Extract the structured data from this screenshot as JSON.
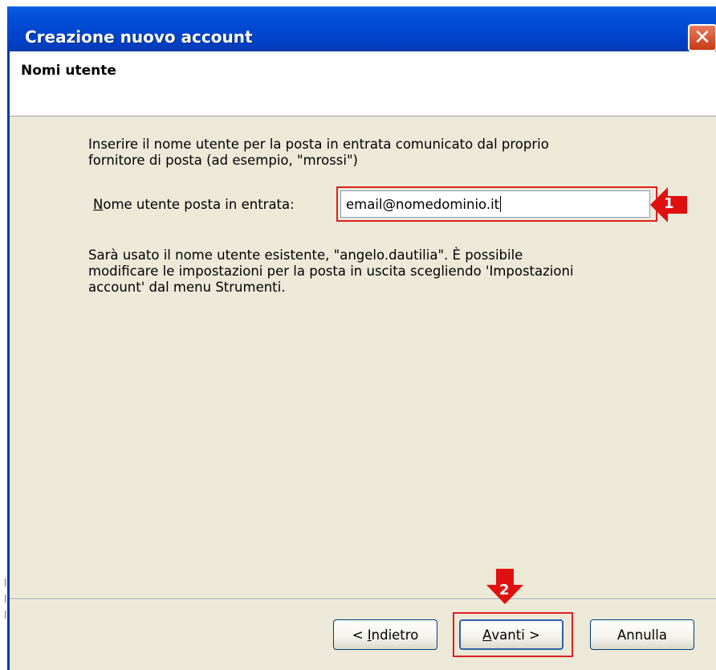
{
  "window": {
    "title": "Creazione nuovo account",
    "close_glyph": "✕"
  },
  "header": {
    "title": "Nomi utente"
  },
  "content": {
    "instruction": "Inserire il nome utente per la posta in entrata comunicato dal proprio\nfornitore di posta (ad esempio, \"mrossi\")",
    "field_label_accel": "N",
    "field_label_rest": "ome utente posta in entrata:",
    "field_value": "email@nomedominio.it",
    "note": "Sarà usato il nome utente esistente, \"angelo.dautilia\". È possibile\nmodificare le impostazioni per la posta in uscita scegliendo 'Impostazioni\naccount' dal menu Strumenti."
  },
  "buttons": {
    "back_prefix": "< ",
    "back_accel": "I",
    "back_rest": "ndietro",
    "next_accel": "A",
    "next_rest": "vanti >",
    "cancel": "Annulla"
  },
  "annotations": {
    "marker_1": "1",
    "marker_2": "2",
    "highlight_color": "#e02020"
  },
  "colors": {
    "titlebar": "#0048d0",
    "content_bg": "#ece9d8",
    "close_button": "#c83a14"
  }
}
